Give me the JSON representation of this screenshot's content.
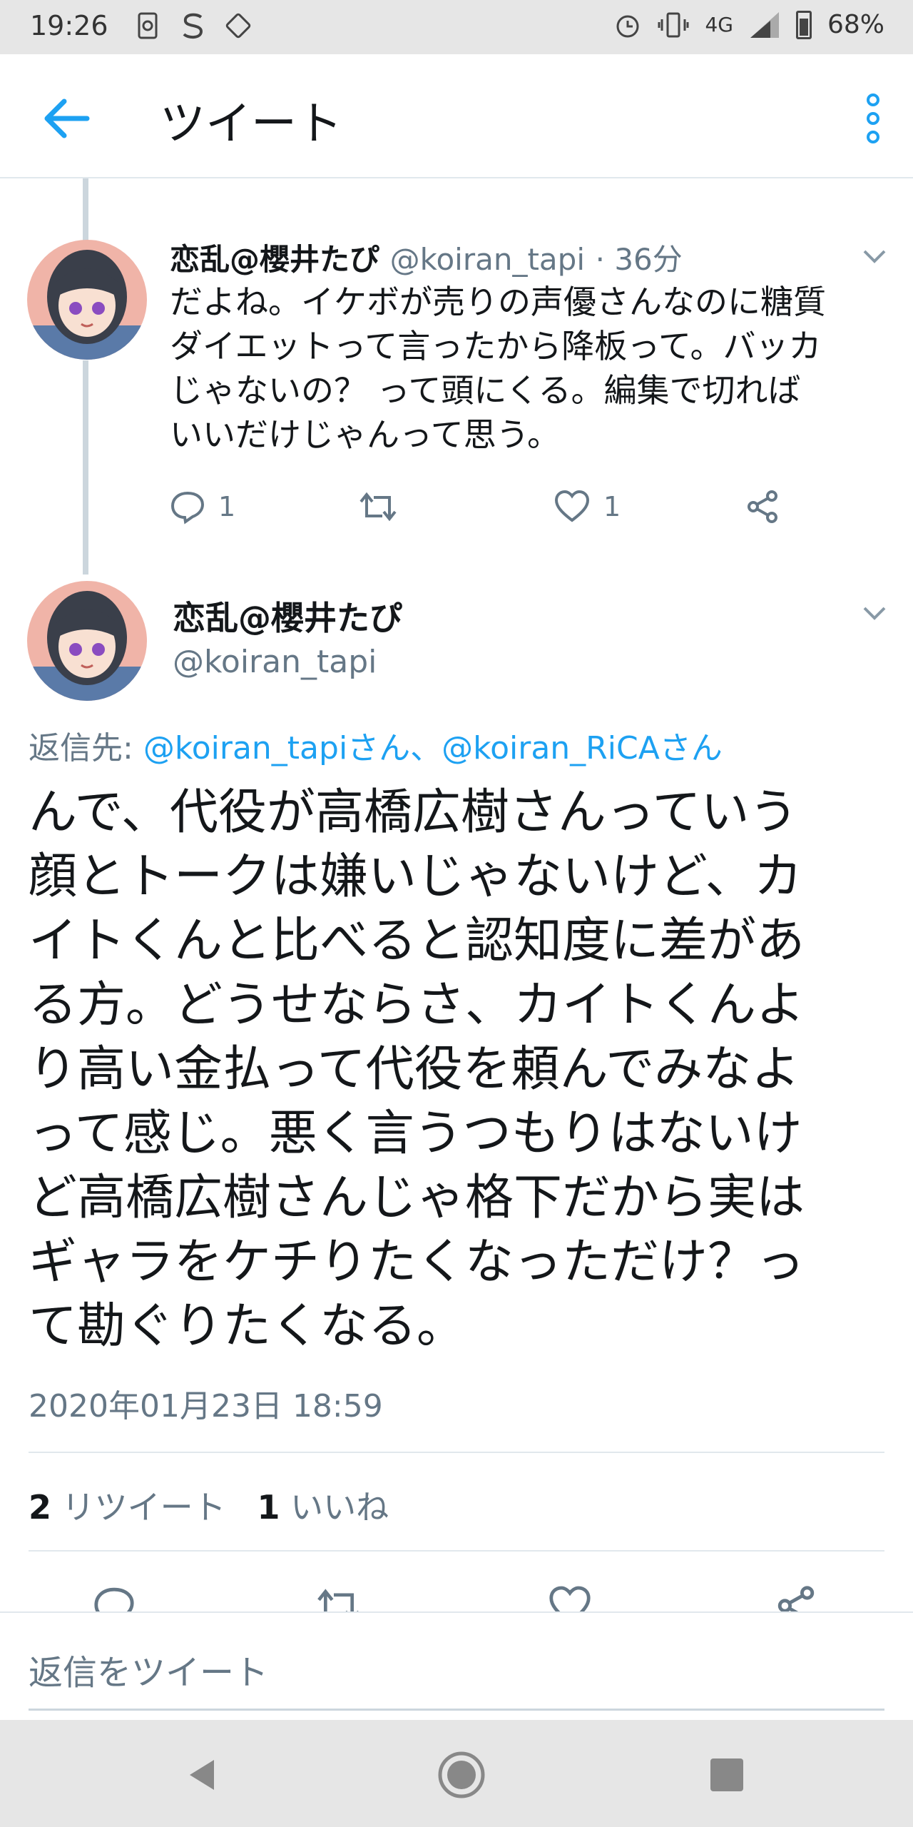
{
  "status_bar": {
    "time": "19:26",
    "network": "4G",
    "battery": "68%"
  },
  "app_bar": {
    "title": "ツイート",
    "icons": [
      "arrow-left-icon",
      "more-vertical-icon"
    ]
  },
  "colors": {
    "accent": "#1da1f2",
    "secondary_text": "#657786",
    "primary_text": "#14171a",
    "divider": "#e1e8ed",
    "thread_line": "#ccd6dd"
  },
  "parent_tweet": {
    "display_name": "恋乱@櫻井たぴ",
    "handle": "@koiran_tapi",
    "time": "· 36分",
    "text": "だよね。イケボが売りの声優さんなのに糖質\nダイエットって言ったから降板って。バッカ\nじゃないの？ って頭にくる。編集で切れば\nいいだけじゃんって思う。",
    "reply_count": "1",
    "like_count": "1"
  },
  "main_tweet": {
    "display_name": "恋乱@櫻井たぴ",
    "handle": "@koiran_tapi",
    "reply_to_label": "返信先: ",
    "reply_to_mentions": "@koiran_tapiさん、@koiran_RiCAさん",
    "text": "んで、代役が高橋広樹さんっていう\n顔とトークは嫌いじゃないけど、カ\nイトくんと比べると認知度に差があ\nる方。どうせならさ、カイトくんよ\nり高い金払って代役を頼んでみなよ\nって感じ。悪く言うつもりはないけ\nど高橋広樹さんじゃ格下だから実は\nギャラをケチりたくなっただけ？っ\nて勘ぐりたくなる。",
    "timestamp": "2020年01月23日 18:59",
    "retweet_count": "2",
    "retweet_label": "リツイート",
    "like_count": "1",
    "like_label": "いいね"
  },
  "reply_composer": {
    "placeholder": "返信をツイート"
  }
}
